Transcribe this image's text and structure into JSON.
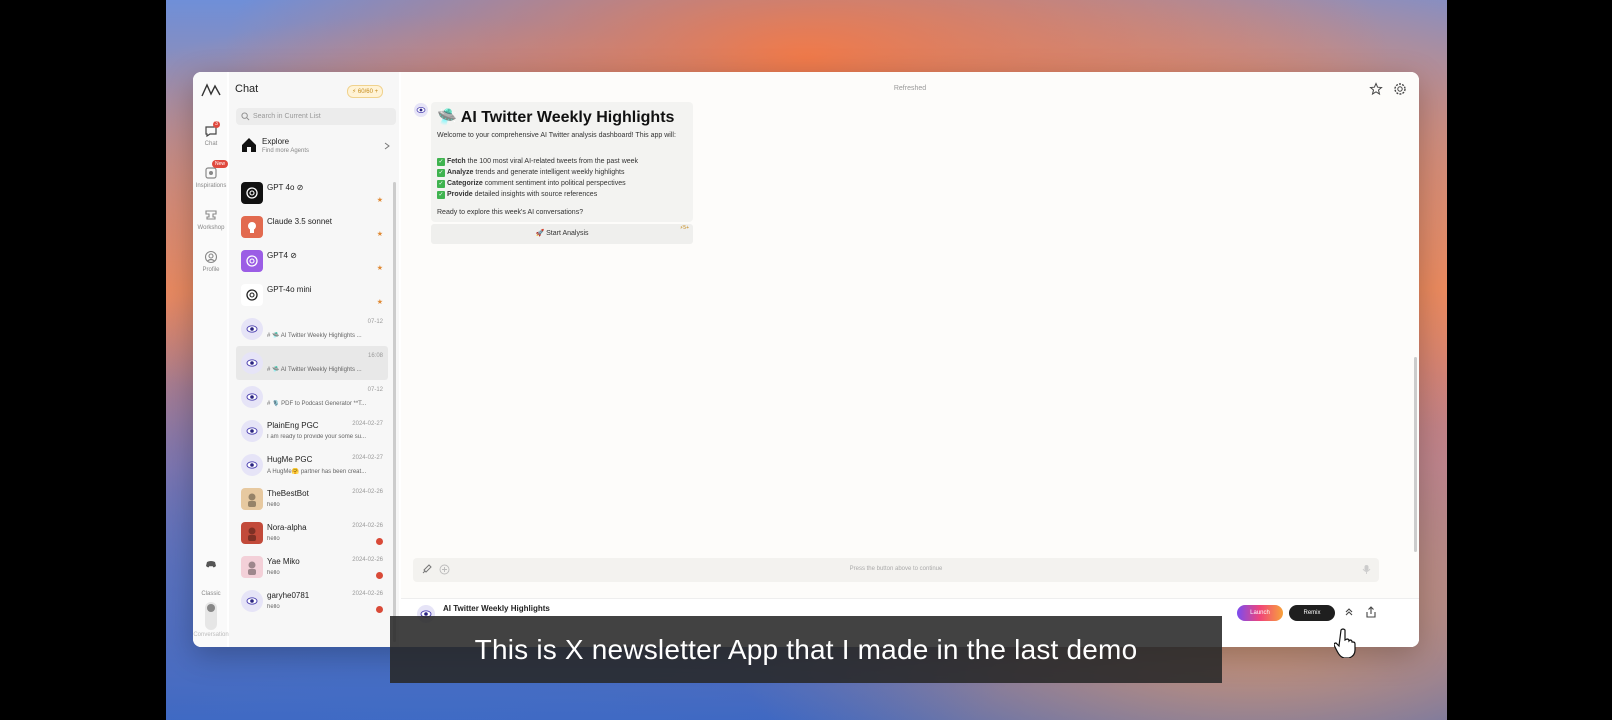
{
  "app": {
    "panel_title": "Chat",
    "credits": "60/60",
    "search_placeholder": "Search in Current List",
    "explore": {
      "title": "Explore",
      "subtitle": "Find more Agents"
    }
  },
  "rail": {
    "chat": "Chat",
    "chat_badge": "3",
    "inspirations": "Inspirations",
    "new_badge": "New",
    "workshop": "Workshop",
    "profile": "Profile",
    "mode": "Classic",
    "mode_option": "Conversation"
  },
  "chat_list": [
    {
      "name": "GPT 4o",
      "msg": "",
      "date": "",
      "marker": "star",
      "verified": true
    },
    {
      "name": "Claude 3.5 sonnet",
      "msg": "",
      "date": "",
      "marker": "star",
      "verified": false
    },
    {
      "name": "GPT4",
      "msg": "",
      "date": "",
      "marker": "star",
      "verified": true
    },
    {
      "name": "GPT-4o mini",
      "msg": "",
      "date": "",
      "marker": "star",
      "verified": false
    },
    {
      "name": "",
      "msg": "# 🛸 AI Twitter Weekly Highlights ...",
      "date": "07-12",
      "marker": "",
      "verified": false
    },
    {
      "name": "",
      "msg": "# 🛸 AI Twitter Weekly Highlights ...",
      "date": "16:08",
      "marker": "",
      "verified": false
    },
    {
      "name": "",
      "msg": "# 🎙️ PDF to Podcast Generator **T...",
      "date": "07-12",
      "marker": "",
      "verified": false
    },
    {
      "name": "PlainEng PGC",
      "msg": "I am ready to provide your some su...",
      "date": "2024-02-27",
      "marker": "",
      "verified": false
    },
    {
      "name": "HugMe PGC",
      "msg": "A HugMe🤗 partner has been creat...",
      "date": "2024-02-27",
      "marker": "",
      "verified": false
    },
    {
      "name": "TheBestBot",
      "msg": "hello",
      "date": "2024-02-26",
      "marker": "",
      "verified": false
    },
    {
      "name": "Nora-alpha",
      "msg": "hello",
      "date": "2024-02-26",
      "marker": "unread",
      "verified": false
    },
    {
      "name": "Yae Miko",
      "msg": "hello",
      "date": "2024-02-26",
      "marker": "unread",
      "verified": false
    },
    {
      "name": "garyhe0781",
      "msg": "hello",
      "date": "2024-02-26",
      "marker": "unread",
      "verified": false
    }
  ],
  "main": {
    "status": "Refreshed",
    "card": {
      "title": "🛸 AI Twitter Weekly Highlights",
      "intro": "Welcome to your comprehensive AI Twitter analysis dashboard! This app will:",
      "steps": [
        {
          "bold": "Fetch",
          "rest": " the 100 most viral AI-related tweets from the past week"
        },
        {
          "bold": "Analyze",
          "rest": " trends and generate intelligent weekly highlights"
        },
        {
          "bold": "Categorize",
          "rest": " comment sentiment into political perspectives"
        },
        {
          "bold": "Provide",
          "rest": " detailed insights with source references"
        }
      ],
      "outro": "Ready to explore this week's AI conversations?"
    },
    "start_button": "🚀 Start Analysis",
    "start_cost": "⚡5+",
    "composer_placeholder": "Press the button above to continue"
  },
  "bottom_bar": {
    "title": "AI Twitter Weekly Highlights",
    "launch": "Launch",
    "remix": "Remix"
  },
  "caption": "This is X newsletter App that I made in the last demo",
  "colors": {
    "launch_gradient": [
      "#7a4cf0",
      "#f0457a",
      "#f8a23a"
    ],
    "remix": "#1f1f1f",
    "unread": "#d94a38",
    "star": "#e08a35"
  }
}
